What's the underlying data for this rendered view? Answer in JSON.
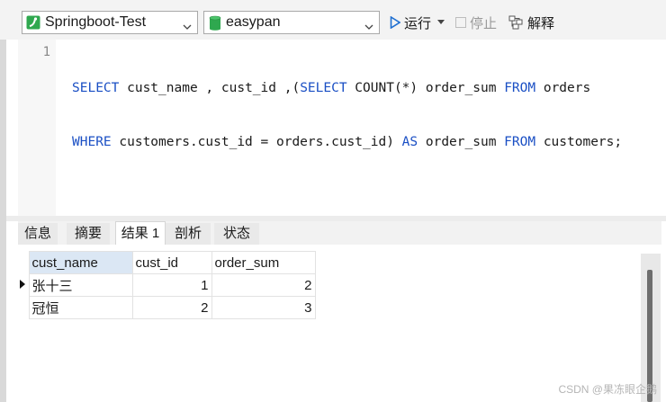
{
  "toolbar": {
    "connection": "Springboot-Test",
    "database": "easypan",
    "run_label": "运行",
    "stop_label": "停止",
    "explain_label": "解释"
  },
  "editor": {
    "line_number": "1",
    "line1": [
      {
        "t": "SELECT",
        "kw": true
      },
      {
        "t": " cust_name , cust_id ,(",
        "kw": false
      },
      {
        "t": "SELECT",
        "kw": true
      },
      {
        "t": " COUNT(*) order_sum ",
        "kw": false
      },
      {
        "t": "FROM",
        "kw": true
      },
      {
        "t": " orders",
        "kw": false
      }
    ],
    "line2": [
      {
        "t": "WHERE",
        "kw": true
      },
      {
        "t": " customers.cust_id = orders.cust_id) ",
        "kw": false
      },
      {
        "t": "AS",
        "kw": true
      },
      {
        "t": " order_sum ",
        "kw": false
      },
      {
        "t": "FROM",
        "kw": true
      },
      {
        "t": " customers;",
        "kw": false
      }
    ]
  },
  "tabs": {
    "info": "信息",
    "summary": "摘要",
    "result1": "结果 1",
    "profile": "剖析",
    "status": "状态"
  },
  "results": {
    "columns": [
      "cust_name",
      "cust_id",
      "order_sum"
    ],
    "rows": [
      [
        "张十三",
        "1",
        "2"
      ],
      [
        "冠恒",
        "2",
        "3"
      ]
    ]
  },
  "watermark": "CSDN @果冻眼企鹅",
  "colors": {
    "keyword": "#1a4fc4",
    "run_icon": "#1f6fd1",
    "db_icon": "#2fa84f",
    "conn_icon": "#2fa84f",
    "selected_header": "#dbe7f4"
  }
}
